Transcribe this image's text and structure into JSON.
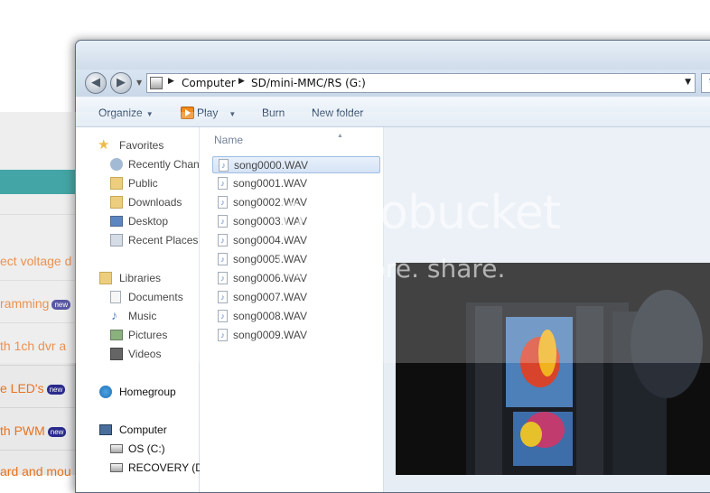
{
  "background_page": {
    "links": [
      {
        "text": "ect voltage d",
        "badge": ""
      },
      {
        "text": "ramming",
        "badge": "new"
      },
      {
        "text": "th 1ch dvr a",
        "badge": ""
      },
      {
        "text": "e LED's",
        "badge": "new"
      },
      {
        "text": "th PWM",
        "badge": "new"
      },
      {
        "text": "ard and mou",
        "badge": ""
      }
    ],
    "teal_color": "#0f8c8c",
    "link_color": "#e8731e"
  },
  "address_bar": {
    "crumbs": [
      "Computer",
      "SD/mini-MMC/RS (G:)"
    ]
  },
  "toolbar": {
    "organize": "Organize",
    "play": "Play",
    "burn": "Burn",
    "new_folder": "New folder"
  },
  "nav_pane": {
    "favorites_header": "Favorites",
    "favorites": [
      "Recently Chan",
      "Public",
      "Downloads",
      "Desktop",
      "Recent Places"
    ],
    "libraries_header": "Libraries",
    "libraries": [
      "Documents",
      "Music",
      "Pictures",
      "Videos"
    ],
    "homegroup": "Homegroup",
    "computer_header": "Computer",
    "drives": [
      "OS (C:)",
      "RECOVERY (D:"
    ]
  },
  "file_list": {
    "column_name": "Name",
    "selected_index": 0,
    "files": [
      "song0000.WAV",
      "song0001.WAV",
      "song0002.WAV",
      "song0003.WAV",
      "song0004.WAV",
      "song0005.WAV",
      "song0006.WAV",
      "song0007.WAV",
      "song0008.WAV",
      "song0009.WAV"
    ]
  },
  "watermark": {
    "line1": "photobucket",
    "line2": "host. store. share."
  }
}
